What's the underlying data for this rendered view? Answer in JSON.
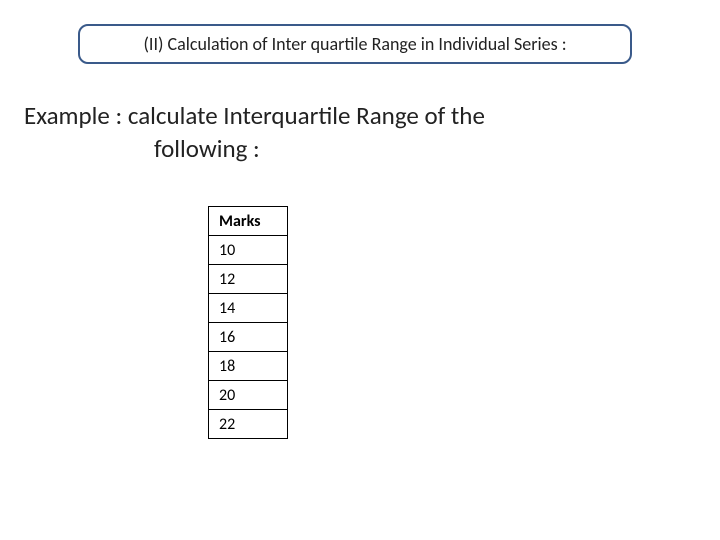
{
  "title": "(II) Calculation of  Inter quartile Range in Individual Series :",
  "example_line1": "Example : calculate Interquartile Range of the",
  "example_line2": "following :",
  "table": {
    "header": "Marks",
    "rows": [
      "10",
      "12",
      "14",
      "16",
      "18",
      "20",
      "22"
    ]
  }
}
